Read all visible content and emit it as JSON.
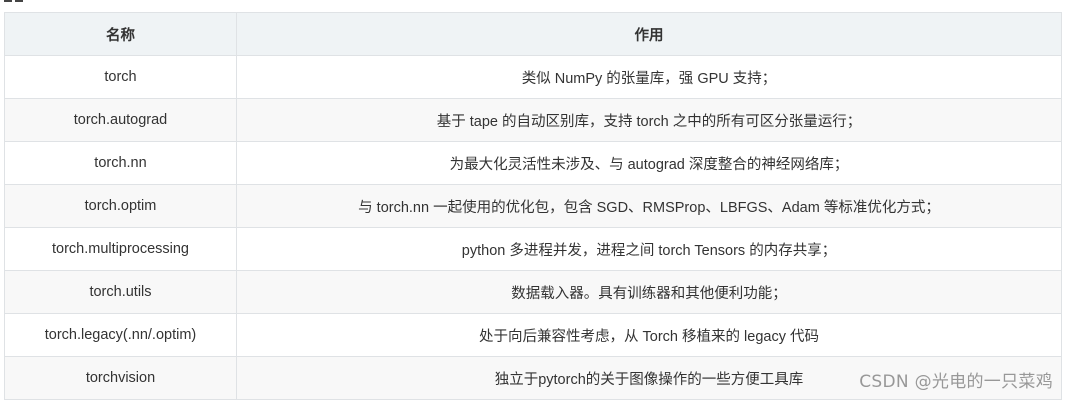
{
  "table": {
    "headers": [
      "名称",
      "作用"
    ],
    "rows": [
      [
        "torch",
        "类似 NumPy 的张量库，强 GPU 支持；"
      ],
      [
        "torch.autograd",
        "基于 tape 的自动区别库，支持 torch 之中的所有可区分张量运行；"
      ],
      [
        "torch.nn",
        "为最大化灵活性未涉及、与 autograd 深度整合的神经网络库；"
      ],
      [
        "torch.optim",
        "与 torch.nn 一起使用的优化包，包含 SGD、RMSProp、LBFGS、Adam 等标准优化方式；"
      ],
      [
        "torch.multiprocessing",
        "python 多进程并发，进程之间 torch Tensors 的内存共享；"
      ],
      [
        "torch.utils",
        "数据载入器。具有训练器和其他便利功能；"
      ],
      [
        "torch.legacy(.nn/.optim)",
        "处于向后兼容性考虑，从 Torch 移植来的 legacy 代码"
      ],
      [
        "torchvision",
        "独立于pytorch的关于图像操作的一些方便工具库"
      ]
    ]
  },
  "watermark": "CSDN @光电的一只菜鸡"
}
